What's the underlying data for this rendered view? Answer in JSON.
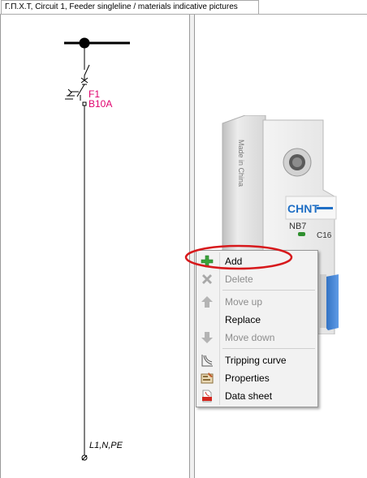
{
  "tab": {
    "title": "Γ.Π.Χ.Τ, Circuit 1, Feeder singleline / materials indicative pictures"
  },
  "schematic": {
    "device_name": "F1",
    "device_rating": "B10A",
    "output_label": "L1,N,PE"
  },
  "breaker_picture": {
    "brand": "CHNT",
    "model": "NB7",
    "rating": "C16",
    "side_text": "Made in China",
    "brand_color": "#1f6fc5"
  },
  "context_menu": {
    "items": [
      {
        "label": "Add",
        "icon": "green-plus-icon",
        "enabled": true
      },
      {
        "label": "Delete",
        "icon": "gray-x-icon",
        "enabled": false
      },
      {
        "label": "Move up",
        "icon": "arrow-up-icon",
        "enabled": false
      },
      {
        "label": "Replace",
        "icon": "",
        "enabled": true
      },
      {
        "label": "Move down",
        "icon": "arrow-down-icon",
        "enabled": false
      },
      {
        "label": "Tripping curve",
        "icon": "tripping-curve-icon",
        "enabled": true
      },
      {
        "label": "Properties",
        "icon": "properties-icon",
        "enabled": true
      },
      {
        "label": "Data sheet",
        "icon": "pdf-icon",
        "enabled": true
      }
    ],
    "highlight_color": "#d7191c"
  }
}
